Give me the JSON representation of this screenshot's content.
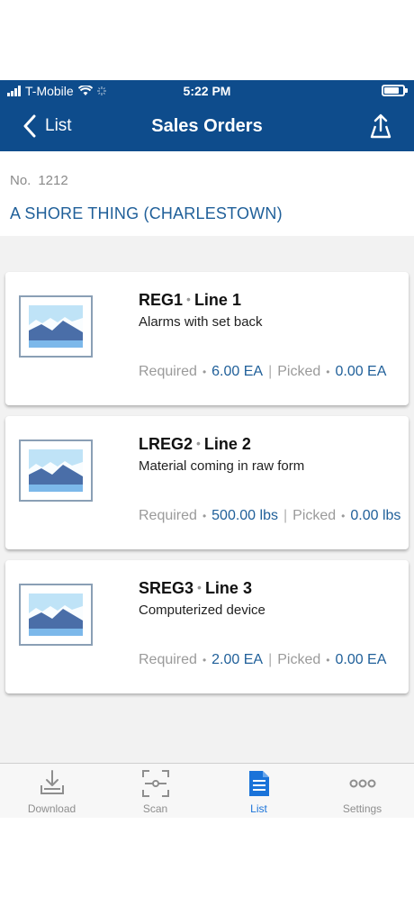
{
  "status": {
    "carrier": "T-Mobile",
    "time": "5:22 PM"
  },
  "nav": {
    "back_label": "List",
    "title": "Sales Orders"
  },
  "order": {
    "no_label": "No.",
    "no_value": "1212",
    "customer": "A SHORE THING (CHARLESTOWN)"
  },
  "lines": [
    {
      "item": "REG1",
      "line": "Line 1",
      "description": "Alarms with set back",
      "required_label": "Required",
      "required": "6.00 EA",
      "picked_label": "Picked",
      "picked": "0.00 EA"
    },
    {
      "item": "LREG2",
      "line": "Line 2",
      "description": "Material coming in raw form",
      "required_label": "Required",
      "required": "500.00 lbs",
      "picked_label": "Picked",
      "picked": "0.00 lbs"
    },
    {
      "item": "SREG3",
      "line": "Line 3",
      "description": "Computerized device",
      "required_label": "Required",
      "required": "2.00 EA",
      "picked_label": "Picked",
      "picked": "0.00 EA"
    }
  ],
  "tabs": [
    {
      "label": "Download",
      "icon": "download-icon"
    },
    {
      "label": "Scan",
      "icon": "scan-icon"
    },
    {
      "label": "List",
      "icon": "list-document-icon",
      "active": true
    },
    {
      "label": "Settings",
      "icon": "more-dots-icon"
    }
  ],
  "colors": {
    "nav": "#0e4c8c",
    "link": "#1f5f99",
    "active_tab": "#1a73d9"
  }
}
